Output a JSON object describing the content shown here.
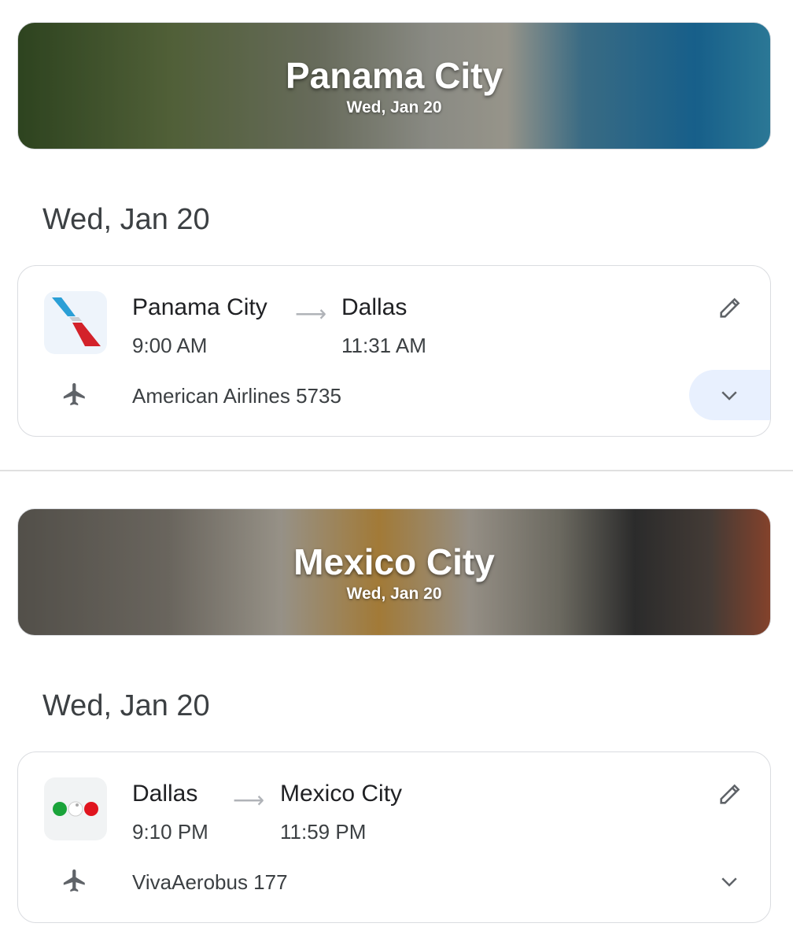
{
  "segments": [
    {
      "hero": {
        "city": "Panama City",
        "date": "Wed, Jan 20"
      },
      "date_heading": "Wed, Jan 20",
      "flight": {
        "origin": "Panama City",
        "destination": "Dallas",
        "depart": "9:00 AM",
        "arrive": "11:31 AM",
        "airline": "American Airlines 5735",
        "logo": "american-airlines-logo",
        "expanded_highlight": true
      }
    },
    {
      "hero": {
        "city": "Mexico City",
        "date": "Wed, Jan 20"
      },
      "date_heading": "Wed, Jan 20",
      "flight": {
        "origin": "Dallas",
        "destination": "Mexico City",
        "depart": "9:10 PM",
        "arrive": "11:59 PM",
        "airline": "VivaAerobus 177",
        "logo": "vivaaerobus-logo",
        "expanded_highlight": false
      }
    }
  ],
  "icons": {
    "edit": "pencil-icon",
    "flight": "airplane-icon",
    "expand": "chevron-down-icon",
    "arrow": "arrow-right-icon"
  },
  "colors": {
    "expand_bg": "#e8f0fe",
    "icon": "#5f6368"
  }
}
